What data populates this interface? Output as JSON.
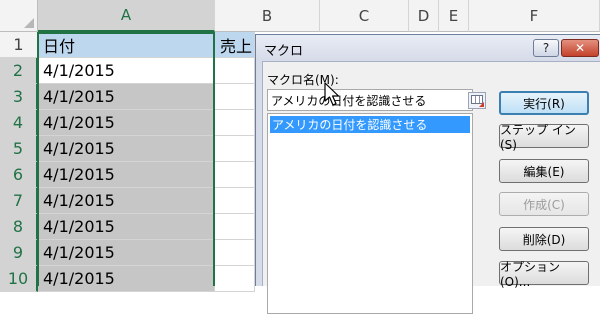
{
  "sheet": {
    "columns": [
      "A",
      "B",
      "C",
      "D",
      "E",
      "F"
    ],
    "rows": [
      "1",
      "2",
      "3",
      "4",
      "5",
      "6",
      "7",
      "8",
      "9",
      "10"
    ],
    "colA": [
      "日付",
      "4/1/2015",
      "4/1/2015",
      "4/1/2015",
      "4/1/2015",
      "4/1/2015",
      "4/1/2015",
      "4/1/2015",
      "4/1/2015",
      "4/1/2015"
    ],
    "colB_header": "売上"
  },
  "dialog": {
    "title": "マクロ",
    "help_label": "?",
    "close_label": "✕",
    "name_label": "マクロ名(M):",
    "name_value": "アメリカの日付を認識させる",
    "list_items": [
      "アメリカの日付を認識させる"
    ],
    "buttons": {
      "run": "実行(R)",
      "step_into": "ステップ イン(S)",
      "edit": "編集(E)",
      "create": "作成(C)",
      "delete": "削除(D)",
      "options": "オプション(O)..."
    }
  },
  "icons": {
    "ref": "range-select-icon",
    "cursor": "mouse-pointer-icon"
  },
  "colors": {
    "header_fill": "#bdd7ee",
    "selection_fill": "#c6c6c6",
    "selection_border": "#217346",
    "list_selected": "#3399ff"
  }
}
